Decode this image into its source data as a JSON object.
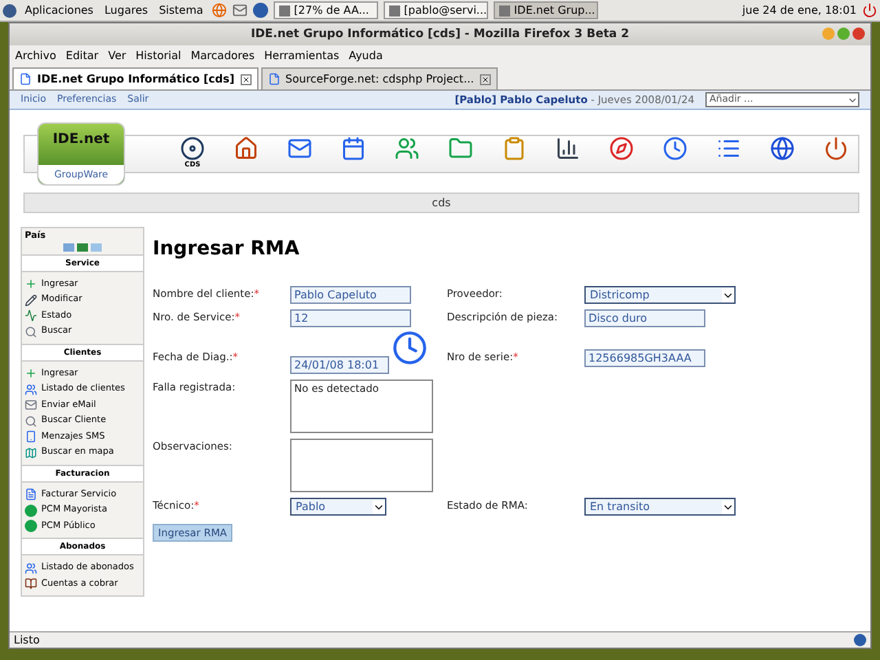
{
  "top_panel": {
    "menus": [
      "Aplicaciones",
      "Lugares",
      "Sistema"
    ],
    "tasks": [
      {
        "label": "[27% de AA...",
        "selected": false
      },
      {
        "label": "[pablo@servi...",
        "selected": false
      },
      {
        "label": "IDE.net Grup...",
        "selected": true
      }
    ],
    "clock": "jue 24 de ene, 18:01"
  },
  "window": {
    "title": "IDE.net Grupo Informático [cds] - Mozilla Firefox 3 Beta 2",
    "menu": [
      "Archivo",
      "Editar",
      "Ver",
      "Historial",
      "Marcadores",
      "Herramientas",
      "Ayuda"
    ],
    "tabs": [
      {
        "label": "IDE.net Grupo Informático [cds]",
        "selected": true
      },
      {
        "label": "SourceForge.net: cdsphp Project...",
        "selected": false
      }
    ]
  },
  "nav": {
    "links": [
      "Inicio",
      "Preferencias",
      "Salir"
    ],
    "user_tag": "[Pablo]",
    "user": "Pablo Capeluto",
    "date": "- Jueves 2008/01/24",
    "add_select": "Añadir ..."
  },
  "header": {
    "logo": "IDE.net",
    "logo_sub": "GroupWare",
    "toolbar": [
      {
        "kind": "cds",
        "label": "CDS"
      },
      {
        "kind": "home"
      },
      {
        "kind": "mail"
      },
      {
        "kind": "calendar"
      },
      {
        "kind": "users"
      },
      {
        "kind": "folder"
      },
      {
        "kind": "clipboard"
      },
      {
        "kind": "chart"
      },
      {
        "kind": "compass"
      },
      {
        "kind": "clock"
      },
      {
        "kind": "list"
      },
      {
        "kind": "globe"
      },
      {
        "kind": "power"
      }
    ],
    "section": "cds"
  },
  "sidebar": {
    "country": "País",
    "sections": [
      {
        "title": "Service",
        "items": [
          {
            "label": "Ingresar",
            "kind": "plus"
          },
          {
            "label": "Modificar",
            "kind": "edit"
          },
          {
            "label": "Estado",
            "kind": "status"
          },
          {
            "label": "Buscar",
            "kind": "search"
          }
        ]
      },
      {
        "title": "Clientes",
        "items": [
          {
            "label": "Ingresar",
            "kind": "plus"
          },
          {
            "label": "Listado de clientes",
            "kind": "users"
          },
          {
            "label": "Enviar eMail",
            "kind": "mail"
          },
          {
            "label": "Buscar Cliente",
            "kind": "search"
          },
          {
            "label": "Menzajes SMS",
            "kind": "phone"
          },
          {
            "label": "Buscar en mapa",
            "kind": "map"
          }
        ]
      },
      {
        "title": "Facturacion",
        "items": [
          {
            "label": "Facturar Servicio",
            "kind": "invoice"
          },
          {
            "label": "PCM Mayorista",
            "kind": "dot"
          },
          {
            "label": "PCM Público",
            "kind": "dot"
          }
        ]
      },
      {
        "title": "Abonados",
        "items": [
          {
            "label": "Listado de abonados",
            "kind": "users"
          },
          {
            "label": "Cuentas a cobrar",
            "kind": "book"
          }
        ]
      }
    ]
  },
  "form": {
    "title": "Ingresar RMA",
    "rows": [
      {
        "left": {
          "label": "Nombre del cliente:",
          "required_mark": "*",
          "kind": "text",
          "value": "Pablo Capeluto"
        },
        "right": {
          "label": "Proveedor:",
          "kind": "select",
          "value": "Districomp"
        }
      },
      {
        "left": {
          "label": "Nro. de Service:",
          "required_mark": "*",
          "kind": "text",
          "value": "12"
        },
        "right": {
          "label": "Descripción de pieza:",
          "kind": "text",
          "value": "Disco duro"
        }
      },
      {
        "left": {
          "label": "Fecha de Diag.:",
          "required_mark": "*",
          "kind": "date",
          "value": "24/01/08 18:01"
        },
        "right": {
          "label": "Nro de serie:",
          "required_mark": "*",
          "kind": "text",
          "value": "12566985GH3AAA"
        }
      },
      {
        "left": {
          "label": "Falla registrada:",
          "kind": "textarea",
          "value": "No es detectado"
        }
      },
      {
        "left": {
          "label": "Observaciones:",
          "kind": "textarea"
        }
      },
      {
        "left": {
          "label": "Técnico:",
          "required_mark": "*",
          "kind": "select",
          "value": "Pablo"
        },
        "right": {
          "label": "Estado de RMA:",
          "kind": "select",
          "value": "En transito"
        }
      }
    ],
    "submit": "Ingresar RMA"
  },
  "status": "Listo"
}
